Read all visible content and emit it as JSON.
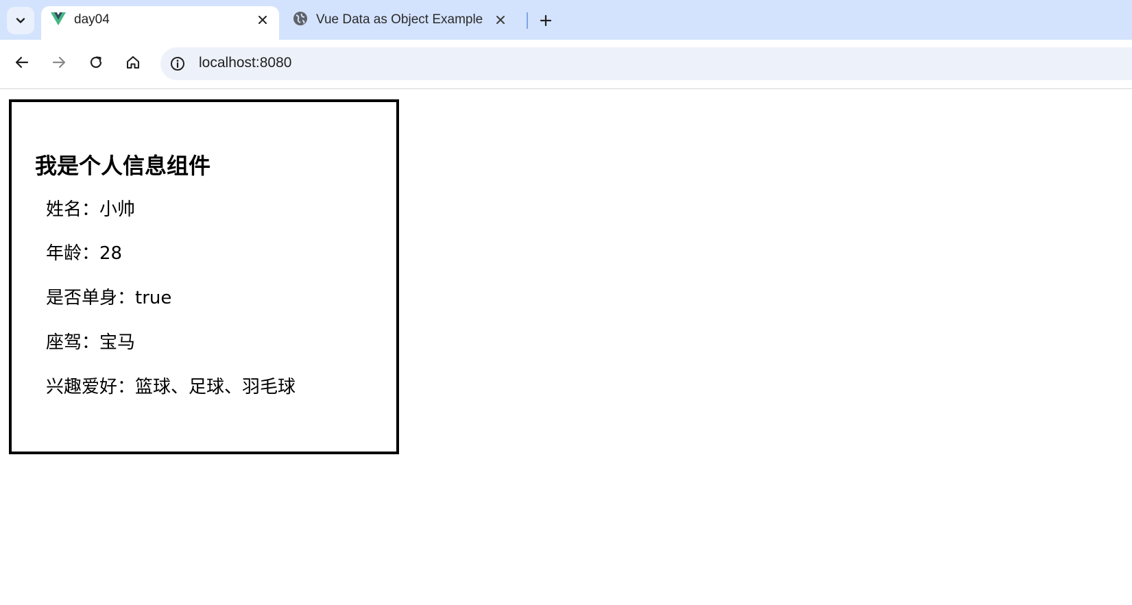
{
  "browser": {
    "tabs": [
      {
        "title": "day04",
        "favicon": "vue-logo-icon",
        "active": true
      },
      {
        "title": "Vue Data as Object Example",
        "favicon": "globe-icon",
        "active": false
      }
    ],
    "address": "localhost:8080",
    "colors": {
      "tabstrip_bg": "#d3e3fd",
      "omnibox_bg": "#edf2fa",
      "vue_green": "#41b883",
      "vue_dark": "#35495e"
    }
  },
  "page": {
    "component_title": "我是个人信息组件",
    "fields": [
      {
        "label": "姓名：",
        "value": "小帅"
      },
      {
        "label": "年龄：",
        "value": "28"
      },
      {
        "label": "是否单身：",
        "value": "true"
      },
      {
        "label": "座驾：",
        "value": "宝马"
      },
      {
        "label": "兴趣爱好：",
        "value": "篮球、足球、羽毛球"
      }
    ]
  }
}
